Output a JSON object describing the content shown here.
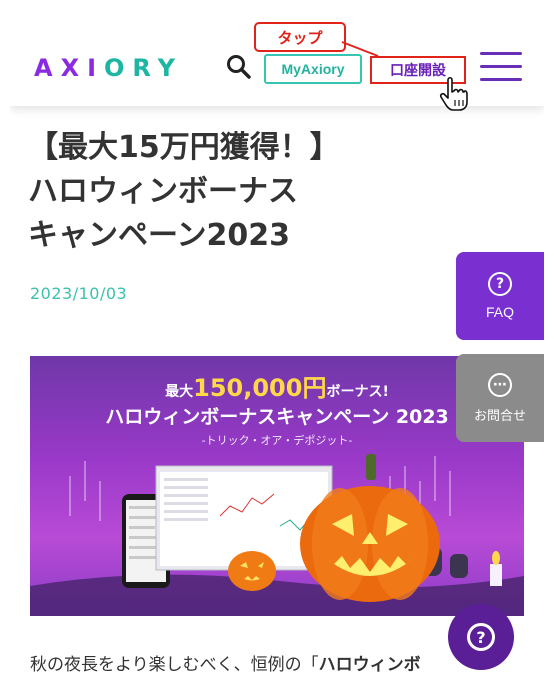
{
  "header": {
    "logo": {
      "part1": "AX",
      "part2": "I",
      "part3": "ORY"
    },
    "search_icon": "search-icon",
    "myaxiory_label": "MyAxiory",
    "open_account_label": "口座開設",
    "menu_icon": "hamburger-menu-icon",
    "tap_callout": "タップ"
  },
  "article": {
    "title_line1": "【最大15万円獲得！】",
    "title_line2": "ハロウィンボーナス",
    "title_line3": "キャンペーン2023",
    "date": "2023/10/03",
    "body_prefix": "秋の夜長をより楽しむべく、恒例の「",
    "body_bold": "ハロウィンボ"
  },
  "banner": {
    "prefix": "最大",
    "amount": "150,000円",
    "suffix": "ボーナス!",
    "headline": "ハロウィンボーナスキャンペーン 2023",
    "subtitle": "-トリック・オア・デポジット-"
  },
  "side": {
    "faq_icon": "question-icon",
    "faq_label": "FAQ",
    "contact_icon": "chat-icon",
    "contact_label": "お問合せ",
    "help_icon": "help-icon"
  },
  "colors": {
    "brand_purple": "#7a2fd0",
    "accent_teal": "#37c4b2",
    "callout_red": "#e2231a"
  }
}
